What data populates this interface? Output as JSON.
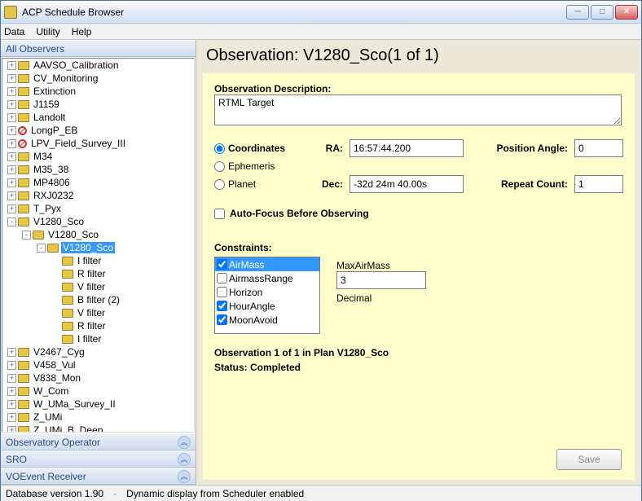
{
  "window": {
    "title": "ACP Schedule Browser"
  },
  "menu": {
    "data": "Data",
    "utility": "Utility",
    "help": "Help"
  },
  "left": {
    "allObservers": "All Observers",
    "observatoryOperator": "Observatory Operator",
    "sro": "SRO",
    "voevent": "VOEvent Receiver"
  },
  "tree": {
    "items": [
      {
        "pm": "+",
        "depth": 0,
        "icon": "folder",
        "label": "AAVSO_Calibration"
      },
      {
        "pm": "+",
        "depth": 0,
        "icon": "folder",
        "label": "CV_Monitoring"
      },
      {
        "pm": "+",
        "depth": 0,
        "icon": "folder",
        "label": "Extinction"
      },
      {
        "pm": "+",
        "depth": 0,
        "icon": "folder",
        "label": "J1159"
      },
      {
        "pm": "+",
        "depth": 0,
        "icon": "folder",
        "label": "Landolt"
      },
      {
        "pm": "+",
        "depth": 0,
        "icon": "noaccess",
        "label": "LongP_EB"
      },
      {
        "pm": "+",
        "depth": 0,
        "icon": "noaccess",
        "label": "LPV_Field_Survey_III"
      },
      {
        "pm": "+",
        "depth": 0,
        "icon": "folder",
        "label": "M34"
      },
      {
        "pm": "+",
        "depth": 0,
        "icon": "folder",
        "label": "M35_38"
      },
      {
        "pm": "+",
        "depth": 0,
        "icon": "folder",
        "label": "MP4806"
      },
      {
        "pm": "+",
        "depth": 0,
        "icon": "folder",
        "label": "RXJ0232"
      },
      {
        "pm": "+",
        "depth": 0,
        "icon": "folder",
        "label": "T_Pyx"
      },
      {
        "pm": "-",
        "depth": 0,
        "icon": "folder",
        "label": "V1280_Sco"
      },
      {
        "pm": "-",
        "depth": 1,
        "icon": "hand",
        "label": "V1280_Sco"
      },
      {
        "pm": "-",
        "depth": 2,
        "icon": "hand",
        "label": "V1280_Sco",
        "sel": true
      },
      {
        "pm": "",
        "depth": 3,
        "icon": "hand",
        "label": "I filter"
      },
      {
        "pm": "",
        "depth": 3,
        "icon": "hand",
        "label": "R filter"
      },
      {
        "pm": "",
        "depth": 3,
        "icon": "hand",
        "label": "V filter"
      },
      {
        "pm": "",
        "depth": 3,
        "icon": "hand",
        "label": "B filter (2)"
      },
      {
        "pm": "",
        "depth": 3,
        "icon": "hand",
        "label": "V filter"
      },
      {
        "pm": "",
        "depth": 3,
        "icon": "hand",
        "label": "R filter"
      },
      {
        "pm": "",
        "depth": 3,
        "icon": "hand",
        "label": "I filter"
      },
      {
        "pm": "+",
        "depth": 0,
        "icon": "folder",
        "label": "V2467_Cyg"
      },
      {
        "pm": "+",
        "depth": 0,
        "icon": "folder",
        "label": "V458_Vul"
      },
      {
        "pm": "+",
        "depth": 0,
        "icon": "folder",
        "label": "V838_Mon"
      },
      {
        "pm": "+",
        "depth": 0,
        "icon": "folder",
        "label": "W_Com"
      },
      {
        "pm": "+",
        "depth": 0,
        "icon": "folder",
        "label": "W_UMa_Survey_II"
      },
      {
        "pm": "+",
        "depth": 0,
        "icon": "folder",
        "label": "Z_UMi"
      },
      {
        "pm": "+",
        "depth": 0,
        "icon": "folder",
        "label": "Z_UMi_B_Deep"
      }
    ]
  },
  "obs": {
    "title": "Observation: V1280_Sco(1 of 1)",
    "descLabel": "Observation Description:",
    "descValue": "RTML Target",
    "coordOpt": "Coordinates",
    "ephOpt": "Ephemeris",
    "planetOpt": "Planet",
    "raLabel": "RA:",
    "raValue": "16:57:44.200",
    "decLabel": "Dec:",
    "decValue": "-32d 24m 40.00s",
    "posAngleLabel": "Position Angle:",
    "posAngleValue": "0",
    "repeatLabel": "Repeat Count:",
    "repeatValue": "1",
    "autoFocus": "Auto-Focus Before Observing",
    "constraintsLabel": "Constraints:",
    "constraints": [
      {
        "label": "AirMass",
        "checked": true,
        "sel": true
      },
      {
        "label": "AirmassRange",
        "checked": false
      },
      {
        "label": "Horizon",
        "checked": false
      },
      {
        "label": "HourAngle",
        "checked": true
      },
      {
        "label": "MoonAvoid",
        "checked": true
      }
    ],
    "paramLabel": "MaxAirMass",
    "paramValue": "3",
    "paramType": "Decimal",
    "planLine": "Observation 1 of 1 in Plan V1280_Sco",
    "statusLine": "Status: Completed",
    "save": "Save"
  },
  "status": {
    "dbver": "Database version 1.90",
    "dyn": "Dynamic display from Scheduler enabled"
  }
}
